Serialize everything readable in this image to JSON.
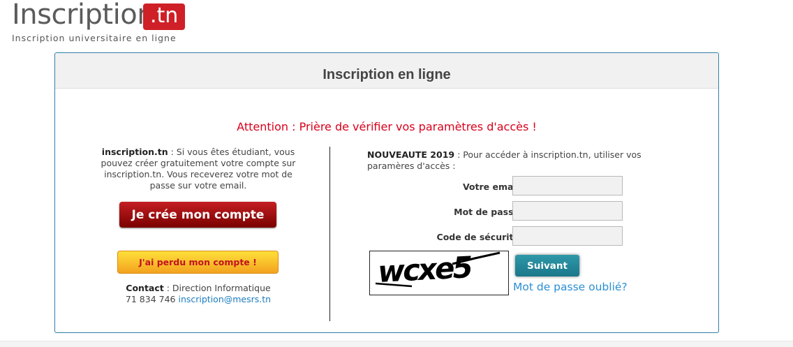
{
  "logo": {
    "word": "Inscription",
    "tld": ".tn",
    "tagline": "Inscription universitaire en ligne"
  },
  "panel": {
    "title": "Inscription en ligne",
    "attention": "Attention : Prière de vérifier vos paramètres d'accès !"
  },
  "left": {
    "intro_bold": "inscription.tn",
    "intro_text": " : Si vous êtes étudiant, vous pouvez créer gratuitement votre compte sur inscription.tn. Vous receverez votre mot de passe sur votre email.",
    "create_button": "Je crée mon compte",
    "lost_button": "J'ai perdu mon compte !",
    "contact_label": "Contact",
    "contact_text": " : Direction Informatique",
    "contact_phone": "71 834 746 ",
    "contact_email": "inscription@mesrs.tn"
  },
  "right": {
    "intro_bold": "NOUVEAUTE 2019",
    "intro_text": " : Pour accéder à inscription.tn, utiliser vos paramères d'accès :",
    "fields": [
      {
        "label": "Votre email",
        "value": ""
      },
      {
        "label": "Mot de passe",
        "value": ""
      },
      {
        "label": "Code de sécurité",
        "value": ""
      }
    ],
    "captcha_text": "wcxe5",
    "submit_button": "Suivant",
    "forgot_link": "Mot de passe oublié?"
  },
  "colors": {
    "panel_border": "#2f7ea8",
    "attention": "#d9001b",
    "create_button": "#a00d12",
    "lost_button": "#f8c22c",
    "submit_button": "#238596",
    "link": "#2a8fd4",
    "logo_badge": "#cf2027"
  }
}
